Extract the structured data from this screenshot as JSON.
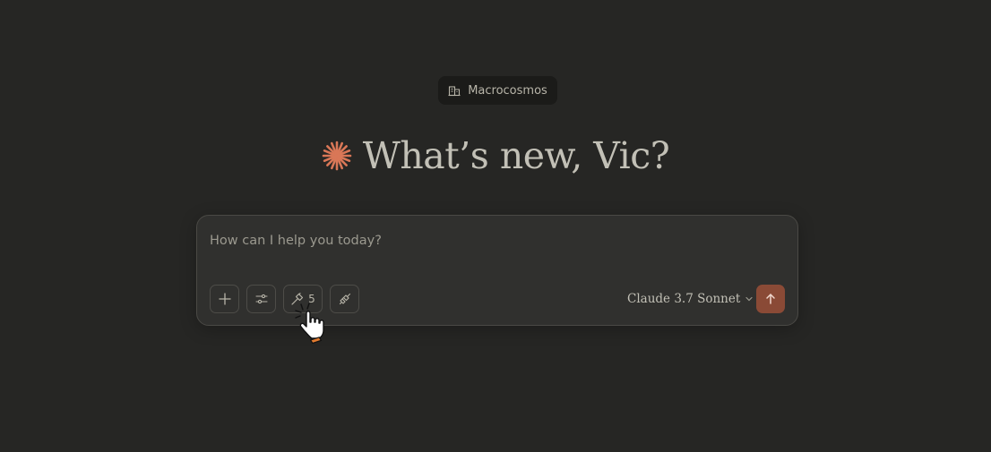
{
  "org": {
    "name": "Macrocosmos",
    "icon": "building-icon"
  },
  "greeting": {
    "text": "What’s new, Vic?",
    "accent_color": "#d97757"
  },
  "composer": {
    "placeholder": "How can I help you today?",
    "value": "",
    "toolbar": {
      "add_icon": "plus-icon",
      "settings_icon": "sliders-icon",
      "tools_icon": "hammer-icon",
      "tools_count": "5",
      "integrations_icon": "plug-icon"
    },
    "model": {
      "name": "Claude 3.7 Sonnet",
      "icon": "chevron-down-icon"
    },
    "send": {
      "icon": "arrow-up-icon",
      "color": "#8a4a36"
    }
  }
}
